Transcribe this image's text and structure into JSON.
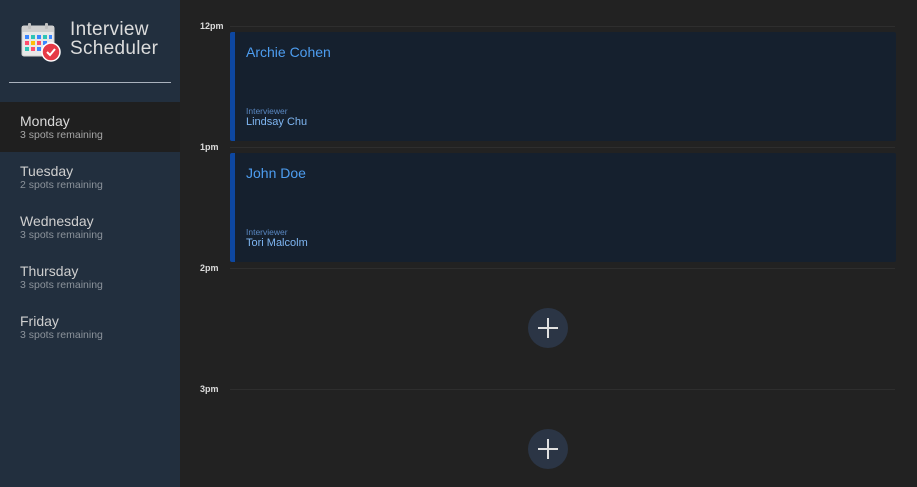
{
  "app": {
    "title_line1": "Interview",
    "title_line2": "Scheduler"
  },
  "days": [
    {
      "name": "Monday",
      "spots": "3 spots remaining",
      "selected": true
    },
    {
      "name": "Tuesday",
      "spots": "2 spots remaining",
      "selected": false
    },
    {
      "name": "Wednesday",
      "spots": "3 spots remaining",
      "selected": false
    },
    {
      "name": "Thursday",
      "spots": "3 spots remaining",
      "selected": false
    },
    {
      "name": "Friday",
      "spots": "3 spots remaining",
      "selected": false
    }
  ],
  "slots": [
    {
      "time": "12pm",
      "student": "Archie Cohen",
      "interviewer_label": "Interviewer",
      "interviewer": "Lindsay Chu"
    },
    {
      "time": "1pm",
      "student": "John Doe",
      "interviewer_label": "Interviewer",
      "interviewer": "Tori Malcolm"
    },
    {
      "time": "2pm"
    },
    {
      "time": "3pm"
    }
  ],
  "icons": {
    "logo": "calendar-check-icon",
    "add": "plus-icon"
  },
  "colors": {
    "sidebar_bg": "#222f3e",
    "main_bg": "#222222",
    "appointment_bg": "#15202e",
    "accent_border": "#0d47a1",
    "student_text": "#4d9df0"
  }
}
